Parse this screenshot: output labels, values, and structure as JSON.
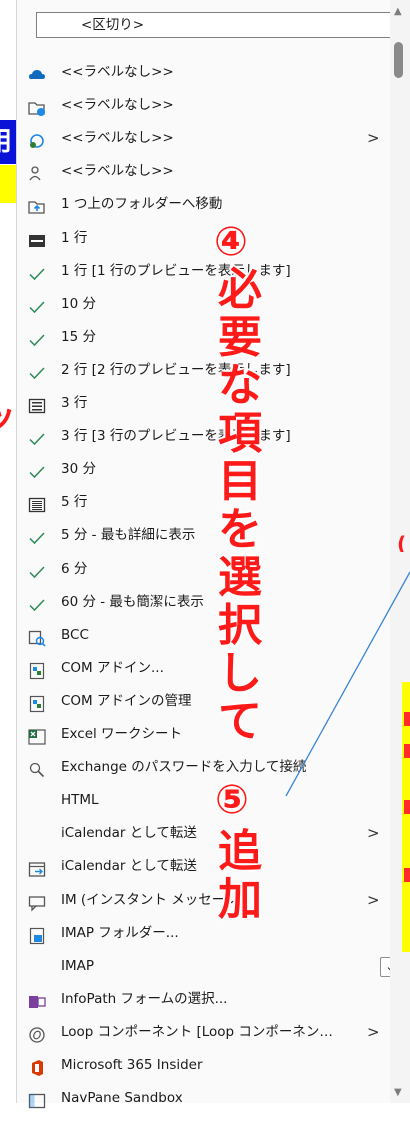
{
  "menu": {
    "separator_label": "<区切り>",
    "items": [
      {
        "icon": "onedrive-cloud-icon",
        "label": "<<ラベルなし>>",
        "chevron": ""
      },
      {
        "icon": "folder-globe-icon",
        "label": "<<ラベルなし>>",
        "chevron": ""
      },
      {
        "icon": "globe-sync-icon",
        "label": "<<ラベルなし>>",
        "chevron": ">"
      },
      {
        "icon": "people-icon",
        "label": "<<ラベルなし>>",
        "chevron": ""
      },
      {
        "icon": "folder-up-icon",
        "label": "1 つ上のフォルダーへ移動",
        "chevron": ""
      },
      {
        "icon": "one-line-icon",
        "label": "1 行",
        "chevron": ""
      },
      {
        "icon": "check-icon",
        "label": "1 行 [1 行のプレビューを表示します]",
        "chevron": ""
      },
      {
        "icon": "check-icon",
        "label": "10 分",
        "chevron": ""
      },
      {
        "icon": "check-icon",
        "label": "15 分",
        "chevron": ""
      },
      {
        "icon": "check-icon",
        "label": "2 行 [2 行のプレビューを表示します]",
        "chevron": ""
      },
      {
        "icon": "three-lines-icon",
        "label": "3 行",
        "chevron": ""
      },
      {
        "icon": "check-icon",
        "label": "3 行 [3 行のプレビューを表示します]",
        "chevron": ""
      },
      {
        "icon": "check-icon",
        "label": "30 分",
        "chevron": ""
      },
      {
        "icon": "five-lines-icon",
        "label": "5 行",
        "chevron": ""
      },
      {
        "icon": "check-icon",
        "label": "5 分 - 最も詳細に表示",
        "chevron": ""
      },
      {
        "icon": "check-icon",
        "label": "6 分",
        "chevron": ""
      },
      {
        "icon": "check-icon",
        "label": "60 分 - 最も簡潔に表示",
        "chevron": ""
      },
      {
        "icon": "bcc-icon",
        "label": "BCC",
        "chevron": ""
      },
      {
        "icon": "com-addin-icon",
        "label": "COM アドイン...",
        "chevron": ""
      },
      {
        "icon": "com-addin-manage-icon",
        "label": "COM アドインの管理",
        "chevron": ""
      },
      {
        "icon": "excel-icon",
        "label": "Excel ワークシート",
        "chevron": ""
      },
      {
        "icon": "key-search-icon",
        "label": "Exchange のパスワードを入力して接続",
        "chevron": ""
      },
      {
        "icon": "",
        "label": "HTML",
        "chevron": ""
      },
      {
        "icon": "",
        "label": "iCalendar として転送",
        "chevron": ">"
      },
      {
        "icon": "calendar-forward-icon",
        "label": "iCalendar として転送",
        "chevron": ""
      },
      {
        "icon": "im-chat-icon",
        "label": "IM (インスタント メッセージ)",
        "chevron": ">"
      },
      {
        "icon": "imap-folder-icon",
        "label": "IMAP フォルダー...",
        "chevron": ""
      },
      {
        "icon": "",
        "label": "IMAP",
        "chevron": "dropdown"
      },
      {
        "icon": "infopath-icon",
        "label": "InfoPath フォームの選択...",
        "chevron": ""
      },
      {
        "icon": "loop-icon",
        "label": "Loop コンポーネント [Loop コンポーネン…",
        "chevron": ">"
      },
      {
        "icon": "office-icon",
        "label": "Microsoft 365 Insider",
        "chevron": ""
      },
      {
        "icon": "navpane-icon",
        "label": "NavPane Sandbox",
        "chevron": ""
      }
    ]
  },
  "annotations": {
    "step4_number": "④",
    "step4_text": "必要な項目を選択して",
    "step5_number": "⑤",
    "step5_text": "追加"
  },
  "left_fragments": {
    "blue": "用",
    "ku": "ック"
  },
  "colors": {
    "annotation": "#ff1a1a",
    "highlight_yellow": "#ffff00",
    "check": "#2e8b57",
    "blue_label": "#0b12d8"
  }
}
